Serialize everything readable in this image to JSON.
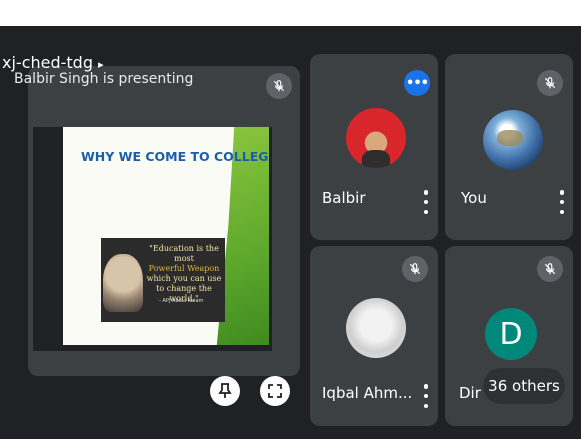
{
  "meeting": {
    "code": "xj-ched-tdg"
  },
  "presentation": {
    "presenter_label": "Balbir Singh is presenting",
    "slide_title": "WHY WE COME TO COLLEGE?",
    "quote_line1": "\"Education is the most",
    "quote_line2": "Powerful Weapon",
    "quote_line3": "which you can use",
    "quote_line4": "to change the world.\"",
    "quote_author": "- APJ Abdul Kalam",
    "pin_icon": "pin-icon",
    "fullscreen_icon": "fullscreen-icon"
  },
  "participants": [
    {
      "name": "Balbir",
      "muted": false,
      "avatar": "photo"
    },
    {
      "name": "You",
      "muted": true,
      "avatar": "earth"
    },
    {
      "name": "Iqbal Ahm...",
      "muted": true,
      "avatar": "photo"
    },
    {
      "name": "Dir",
      "muted": true,
      "avatar_letter": "D"
    }
  ],
  "others_label": "36 others",
  "colors": {
    "background": "#202124",
    "tile": "#3c4043",
    "accent": "#1a73e8",
    "avatar_d": "#00897b"
  }
}
